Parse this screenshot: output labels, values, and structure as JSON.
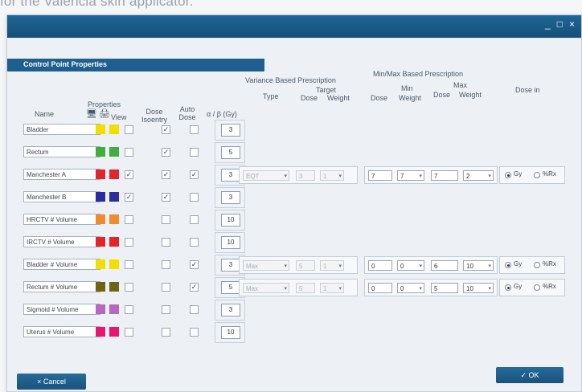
{
  "caption": "for the Valencia skin applicator.",
  "window_controls": [
    "_",
    "□",
    "×"
  ],
  "dialog_title": "Control Point Properties",
  "headers": {
    "properties": "Properties",
    "name": "Name",
    "view": "View",
    "dose_isoentry": "Dose Isoentry",
    "auto_dose": "Auto Dose",
    "ab": "α / β (Gy)",
    "variance_title": "Variance Based Prescription",
    "type": "Type",
    "target": "Target",
    "dose": "Dose",
    "weight": "Weight",
    "minmax_title": "Min/Max Based Prescription",
    "min": "Min",
    "max": "Max",
    "dose_in": "Dose in"
  },
  "rows": [
    {
      "name": "Bladder",
      "color": "#f2df00",
      "view": false,
      "dose": true,
      "auto": false,
      "ab": "3"
    },
    {
      "name": "Rectum",
      "color": "#3fae3f",
      "view": false,
      "dose": true,
      "auto": false,
      "ab": "5"
    },
    {
      "name": "Manchester A",
      "color": "#e0262b",
      "view": true,
      "dose": true,
      "auto": true,
      "ab": "3"
    },
    {
      "name": "Manchester B",
      "color": "#2b2b9e",
      "view": true,
      "dose": true,
      "auto": false,
      "ab": "3"
    },
    {
      "name": "HRCTV # Volume",
      "color": "#f08a2e",
      "view": false,
      "dose": false,
      "auto": false,
      "ab": "10"
    },
    {
      "name": "IRCTV # Volume",
      "color": "#e0262b",
      "view": false,
      "dose": false,
      "auto": false,
      "ab": "10"
    },
    {
      "name": "Bladder # Volume",
      "color": "#f2df00",
      "view": false,
      "dose": false,
      "auto": true,
      "ab": "3"
    },
    {
      "name": "Rectum # Volume",
      "color": "#6e6416",
      "view": false,
      "dose": false,
      "auto": true,
      "ab": "5"
    },
    {
      "name": "Sigmoid # Volume",
      "color": "#b468c0",
      "view": false,
      "dose": false,
      "auto": false,
      "ab": "3"
    },
    {
      "name": "Uterus # Volume",
      "color": "#e8166f",
      "view": false,
      "dose": false,
      "auto": false,
      "ab": "10"
    }
  ],
  "prescriptions": [
    {
      "row": 2,
      "type": "EQT",
      "target_dose": "3",
      "target_weight": "1",
      "min_dose": "7",
      "min_weight": "7",
      "max_dose": "7",
      "max_weight": "2",
      "unit": "Gy",
      "unit_alt": "%Rx",
      "dose_in_selected": "Gy"
    },
    {
      "row": 6,
      "type": "Max",
      "target_dose": "5",
      "target_weight": "1",
      "min_dose": "0",
      "min_weight": "0",
      "max_dose": "6",
      "max_weight": "10",
      "unit": "Gy",
      "unit_alt": "%Rx",
      "dose_in_selected": "Gy"
    },
    {
      "row": 7,
      "type": "Max",
      "target_dose": "5",
      "target_weight": "1",
      "min_dose": "0",
      "min_weight": "0",
      "max_dose": "5",
      "max_weight": "10",
      "unit": "Gy",
      "unit_alt": "%Rx",
      "dose_in_selected": "Gy"
    }
  ],
  "buttons": {
    "cancel": "× Cancel",
    "ok": "✓ OK"
  }
}
